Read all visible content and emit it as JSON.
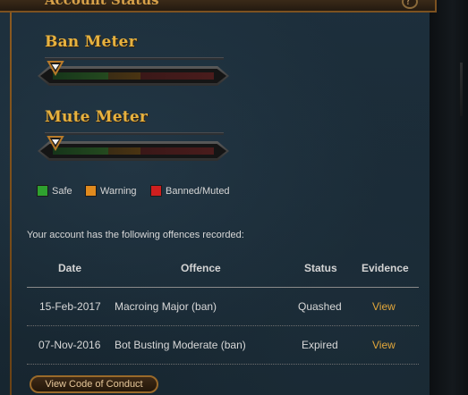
{
  "header": {
    "title": "Account Status",
    "close_glyph": "?"
  },
  "ban_meter": {
    "title": "Ban Meter",
    "level": 0
  },
  "mute_meter": {
    "title": "Mute Meter",
    "level": 0
  },
  "legend": [
    {
      "label": "Safe",
      "color": "#2fa12f"
    },
    {
      "label": "Warning",
      "color": "#e08a1e"
    },
    {
      "label": "Banned/Muted",
      "color": "#cf1f1f"
    }
  ],
  "intro_text": "Your account has the following offences recorded:",
  "table": {
    "headers": {
      "date": "Date",
      "offence": "Offence",
      "status": "Status",
      "evidence": "Evidence"
    },
    "rows": [
      {
        "date": "15-Feb-2017",
        "offence": "Macroing Major (ban)",
        "status": "Quashed",
        "evidence": "View"
      },
      {
        "date": "07-Nov-2016",
        "offence": "Bot Busting Moderate (ban)",
        "status": "Expired",
        "evidence": "View"
      }
    ]
  },
  "buttons": {
    "code_of_conduct": "View Code of Conduct"
  },
  "colors": {
    "accent_gold": "#e7b23f",
    "link": "#e3a73a",
    "panel_border": "#7d5220"
  }
}
